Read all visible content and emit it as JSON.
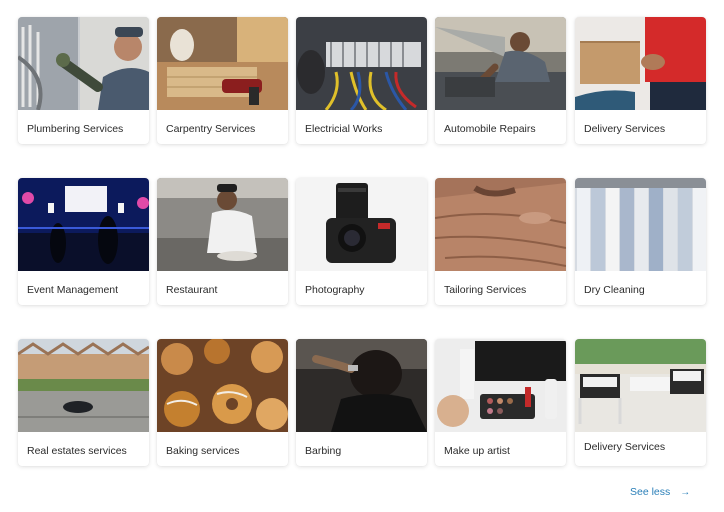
{
  "services": [
    {
      "label": "Plumbering Services",
      "image": "plumber-working-on-pipes"
    },
    {
      "label": "Carpentry Services",
      "image": "carpenter-with-drill"
    },
    {
      "label": "Electricial Works",
      "image": "electrical-panel-wiring"
    },
    {
      "label": "Automobile Repairs",
      "image": "mechanic-under-car-hood"
    },
    {
      "label": "Delivery Services",
      "image": "courier-handing-box"
    },
    {
      "label": "Event Management",
      "image": "concert-stage-lights"
    },
    {
      "label": "Restaurant",
      "image": "chef-plating-food"
    },
    {
      "label": "Photography",
      "image": "dslr-camera"
    },
    {
      "label": "Tailoring Services",
      "image": "fabric-being-cut"
    },
    {
      "label": "Dry Cleaning",
      "image": "shirts-on-rack"
    },
    {
      "label": "Real estates services",
      "image": "row-of-houses"
    },
    {
      "label": "Baking services",
      "image": "pastries-and-donuts"
    },
    {
      "label": "Barbing",
      "image": "barber-cutting-hair"
    },
    {
      "label": "Make up artist",
      "image": "makeup-products"
    },
    {
      "label": "Delivery Services",
      "image": "outdoor-patio-furniture"
    }
  ],
  "footer": {
    "see_less_label": "See less",
    "arrow_icon": "arrow-right-icon"
  },
  "colors": {
    "link": "#2a7fb8",
    "label": "#2b2b2b",
    "background": "#ffffff"
  }
}
